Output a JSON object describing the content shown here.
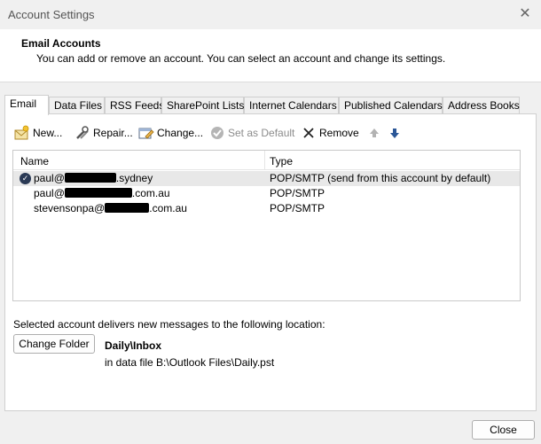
{
  "window": {
    "title": "Account Settings",
    "close_glyph": "✕"
  },
  "header": {
    "title": "Email Accounts",
    "subtitle": "You can add or remove an account. You can select an account and change its settings."
  },
  "tabs": [
    {
      "label": "Email",
      "active": true
    },
    {
      "label": "Data Files"
    },
    {
      "label": "RSS Feeds"
    },
    {
      "label": "SharePoint Lists"
    },
    {
      "label": "Internet Calendars"
    },
    {
      "label": "Published Calendars"
    },
    {
      "label": "Address Books"
    }
  ],
  "toolbar": {
    "new_label": "New...",
    "repair_label": "Repair...",
    "change_label": "Change...",
    "set_default_label": "Set as Default",
    "remove_label": "Remove",
    "move_up_icon": "arrow-up-icon",
    "move_down_icon": "arrow-down-icon"
  },
  "accounts": {
    "columns": {
      "name": "Name",
      "type": "Type"
    },
    "rows": [
      {
        "name_prefix": "paul@",
        "name_suffix": ".sydney",
        "type": "POP/SMTP (send from this account by default)",
        "default": true
      },
      {
        "name_prefix": "paul@",
        "name_suffix": ".com.au",
        "type": "POP/SMTP"
      },
      {
        "name_prefix": "stevensonpa@",
        "name_suffix": ".com.au",
        "type": "POP/SMTP"
      }
    ]
  },
  "delivery": {
    "label": "Selected account delivers new messages to the following location:",
    "change_folder_label": "Change Folder",
    "folder": "Daily\\Inbox",
    "file": "in data file B:\\Outlook Files\\Daily.pst"
  },
  "footer": {
    "close_label": "Close"
  },
  "colors": {
    "accent": "#2b5797",
    "selected_row": "#e8e8e8"
  }
}
